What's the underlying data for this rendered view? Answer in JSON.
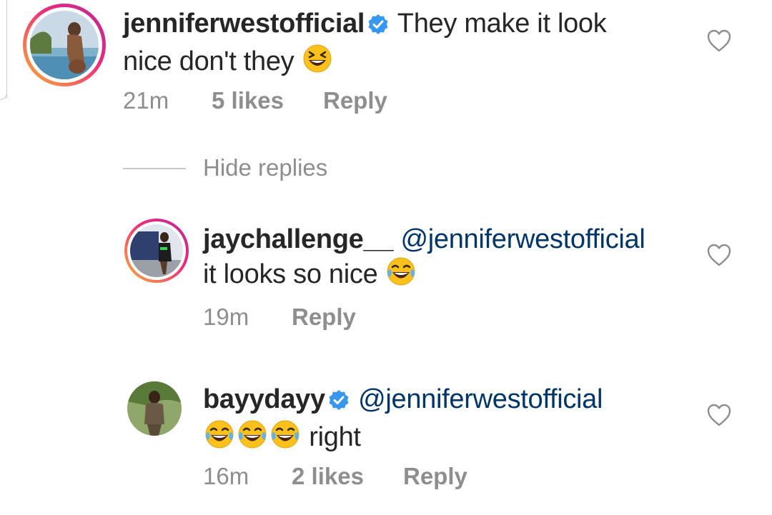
{
  "comment": {
    "username": "jenniferwestofficial",
    "verified": true,
    "text_line1": "They make it look",
    "text_line2": "nice don't they",
    "emoji": "grinning-squinting-face",
    "time": "21m",
    "likes": "5 likes",
    "reply_label": "Reply"
  },
  "hide_replies_label": "Hide replies",
  "replies": [
    {
      "username": "jaychallenge__",
      "verified": false,
      "mention": "@jenniferwestofficial",
      "text": "it looks so nice",
      "emoji": "face-with-tears-of-joy",
      "time": "19m",
      "reply_label": "Reply"
    },
    {
      "username": "bayydayy",
      "verified": true,
      "mention": "@jenniferwestofficial",
      "text": "right",
      "emoji": "face-with-tears-of-joy x3",
      "time": "16m",
      "likes": "2 likes",
      "reply_label": "Reply"
    }
  ],
  "colors": {
    "text": "#262626",
    "secondary": "#8e8e8e",
    "mention": "#003569",
    "verified_badge": "#3897f0",
    "story_ring_start": "#f9b235",
    "story_ring_end": "#b42a9a"
  },
  "icons": [
    "verified-badge-icon",
    "heart-outline-icon",
    "emoji-icon"
  ]
}
